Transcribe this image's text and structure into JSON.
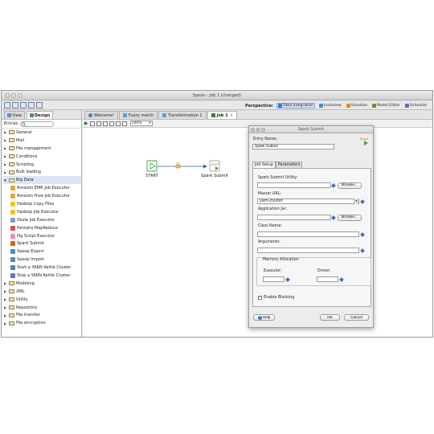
{
  "window": {
    "title": "Spoon - Job 1 (changed)"
  },
  "perspective": {
    "label": "Perspective:",
    "items": [
      {
        "label": "Data Integration",
        "active": true,
        "icon": "data-integration-icon",
        "color": "#3a7bd5"
      },
      {
        "label": "Instaview",
        "active": false,
        "icon": "instaview-icon",
        "color": "#4a90c2"
      },
      {
        "label": "Visualize",
        "active": false,
        "icon": "visualize-icon",
        "color": "#e08a2b"
      },
      {
        "label": "Model Editor",
        "active": false,
        "icon": "model-editor-icon",
        "color": "#6b8e23"
      },
      {
        "label": "Schedule",
        "active": false,
        "icon": "schedule-icon",
        "color": "#7a5fb5"
      }
    ]
  },
  "left_panel": {
    "tabs": {
      "view": "View",
      "design": "Design"
    },
    "entries_label": "Entries",
    "search_placeholder": "",
    "tree": [
      {
        "label": "General",
        "expanded": false,
        "level": 0
      },
      {
        "label": "Mail",
        "expanded": false,
        "level": 0
      },
      {
        "label": "File management",
        "expanded": false,
        "level": 0
      },
      {
        "label": "Conditions",
        "expanded": false,
        "level": 0
      },
      {
        "label": "Scripting",
        "expanded": false,
        "level": 0
      },
      {
        "label": "Bulk loading",
        "expanded": false,
        "level": 0
      },
      {
        "label": "Big Data",
        "expanded": true,
        "level": 0,
        "selected": true
      },
      {
        "label": "Amazon EMR Job Executor",
        "level": 1,
        "icon": "amazon-emr-icon",
        "color": "#e8a33b"
      },
      {
        "label": "Amazon Hive Job Executor",
        "level": 1,
        "icon": "amazon-hive-icon",
        "color": "#e8a33b"
      },
      {
        "label": "Hadoop Copy Files",
        "level": 1,
        "icon": "hadoop-copy-icon",
        "color": "#f0c419"
      },
      {
        "label": "Hadoop Job Executor",
        "level": 1,
        "icon": "hadoop-job-icon",
        "color": "#f0c419"
      },
      {
        "label": "Oozie Job Executor",
        "level": 1,
        "icon": "oozie-icon",
        "color": "#7a9cc6"
      },
      {
        "label": "Pentaho MapReduce",
        "level": 1,
        "icon": "mapreduce-icon",
        "color": "#d9534f"
      },
      {
        "label": "Pig Script Executor",
        "level": 1,
        "icon": "pig-icon",
        "color": "#e890b8"
      },
      {
        "label": "Spark Submit",
        "level": 1,
        "icon": "spark-icon",
        "color": "#e25a1c"
      },
      {
        "label": "Sqoop Export",
        "level": 1,
        "icon": "sqoop-export-icon",
        "color": "#4a90c2"
      },
      {
        "label": "Sqoop Import",
        "level": 1,
        "icon": "sqoop-import-icon",
        "color": "#4a90c2"
      },
      {
        "label": "Start a YARN Kettle Cluster",
        "level": 1,
        "icon": "yarn-start-icon",
        "color": "#5a7fb5"
      },
      {
        "label": "Stop a YARN Kettle Cluster",
        "level": 1,
        "icon": "yarn-stop-icon",
        "color": "#5a7fb5"
      },
      {
        "label": "Modeling",
        "expanded": false,
        "level": 0
      },
      {
        "label": "XML",
        "expanded": false,
        "level": 0
      },
      {
        "label": "Utility",
        "expanded": false,
        "level": 0
      },
      {
        "label": "Repository",
        "expanded": false,
        "level": 0
      },
      {
        "label": "File transfer",
        "expanded": false,
        "level": 0
      },
      {
        "label": "File encryption",
        "expanded": false,
        "level": 0
      }
    ]
  },
  "editor": {
    "tabs": [
      {
        "label": "Welcome!",
        "active": false,
        "icon": "welcome-icon"
      },
      {
        "label": "Fuzzy match",
        "active": false,
        "icon": "transformation-icon"
      },
      {
        "label": "Transformation 1",
        "active": false,
        "icon": "transformation-icon"
      },
      {
        "label": "Job 1",
        "active": true,
        "icon": "job-icon"
      }
    ],
    "zoom": "100%",
    "nodes": {
      "start": "START",
      "spark": "Spark Submit",
      "spark_badge": "Spark"
    }
  },
  "dialog": {
    "title": "Spark Submit",
    "entry_name_label": "Entry Name:",
    "entry_name_value": "Spark Submit",
    "logo_text": "Spark",
    "tabs": {
      "job_setup": "Job Setup",
      "parameters": "Parameters"
    },
    "utility_label": "Spark Submit Utility:",
    "utility_value": "",
    "browse": "Browse...",
    "master_label": "Master URL:",
    "master_value": "yarn-cluster",
    "jar_label": "Application Jar:",
    "jar_value": "",
    "class_label": "Class Name:",
    "class_value": "",
    "args_label": "Arguments:",
    "args_value": "",
    "memory_group": "Memory Allocation",
    "executor_label": "Executor:",
    "executor_value": "",
    "driver_label": "Driver:",
    "driver_value": "",
    "blocking_label": "Enable Blocking",
    "blocking_checked": true,
    "help": "Help",
    "ok": "OK",
    "cancel": "Cancel"
  },
  "colors": {
    "accent": "#3b6fc9",
    "start_green": "#3aa63a",
    "spark_orange": "#e25a1c"
  }
}
